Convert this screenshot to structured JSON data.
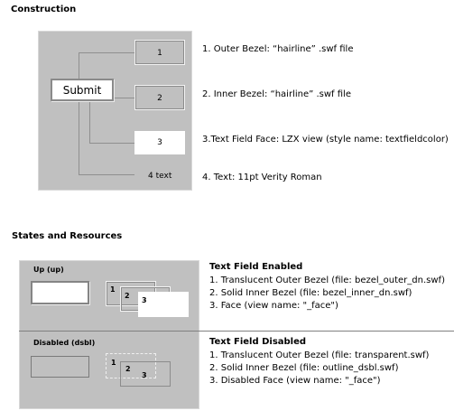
{
  "construction": {
    "heading": "Construction",
    "submit_label": "Submit",
    "box_numbers": [
      "1",
      "2",
      "3"
    ],
    "text_label": "4  text",
    "descriptions": [
      "1. Outer Bezel: “hairline” .swf file",
      "2. Inner Bezel: “hairline” .swf file",
      "3.Text Field Face: LZX view (style name: textfieldcolor)",
      "4. Text: 11pt Verity Roman"
    ]
  },
  "states": {
    "heading": "States and Resources",
    "enabled": {
      "state_label": "Up (up)",
      "layer_numbers": [
        "1",
        "2",
        "3"
      ],
      "title": "Text Field Enabled",
      "lines": [
        "1. Translucent Outer Bezel (file: bezel_outer_dn.swf)",
        "2. Solid Inner Bezel (file: bezel_inner_dn.swf)",
        "3. Face (view name: \"_face\")"
      ]
    },
    "disabled": {
      "state_label": "Disabled  (dsbl)",
      "layer_numbers": [
        "1",
        "2",
        "3"
      ],
      "title": "Text Field Disabled",
      "lines": [
        "1. Translucent Outer Bezel (file: transparent.swf)",
        "2. Solid Inner Bezel (file: outline_dsbl.swf)",
        "3. Disabled Face (view name: \"_face\")"
      ]
    }
  }
}
